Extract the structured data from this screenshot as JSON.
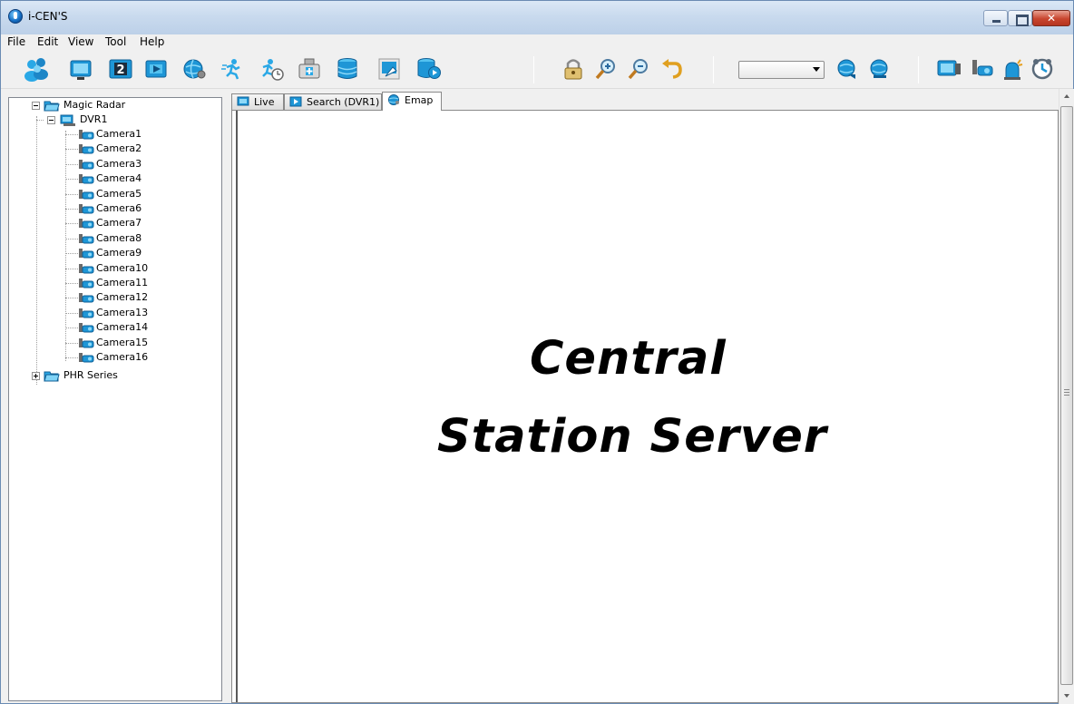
{
  "window": {
    "title": "i-CEN'S",
    "close_glyph": "✕"
  },
  "menu": [
    "File",
    "Edit",
    "View",
    "Tool",
    "Help"
  ],
  "toolbar": {
    "left_buttons": [
      "users-icon",
      "live-monitor-icon",
      "split-2-icon",
      "channel-view-icon",
      "globe-settings-icon",
      "motion-search-icon",
      "motion-schedule-icon",
      "backup-device-icon",
      "database-icon",
      "export-clip-icon",
      "database-play-icon"
    ],
    "map_buttons": [
      "lock-icon",
      "zoom-in-icon",
      "zoom-out-icon",
      "undo-icon"
    ],
    "combo_value": "",
    "globe_buttons": [
      "globe-prev-icon",
      "globe-next-icon"
    ],
    "right_buttons": [
      "monitor-camera-icon",
      "camera-icon",
      "alarm-bell-icon",
      "clock-icon"
    ]
  },
  "tree": {
    "root": {
      "label": "Magic Radar"
    },
    "dvr": {
      "label": "DVR1"
    },
    "cameras": [
      "Camera1",
      "Camera2",
      "Camera3",
      "Camera4",
      "Camera5",
      "Camera6",
      "Camera7",
      "Camera8",
      "Camera9",
      "Camera10",
      "Camera11",
      "Camera12",
      "Camera13",
      "Camera14",
      "Camera15",
      "Camera16"
    ],
    "series": {
      "label": "PHR Series"
    }
  },
  "tabs": [
    {
      "label": "Live",
      "icon": "monitor-icon",
      "active": false
    },
    {
      "label": "Search (DVR1)",
      "icon": "search-video-icon",
      "active": false
    },
    {
      "label": "Emap",
      "icon": "globe-icon",
      "active": true
    }
  ],
  "main": {
    "line1": "Central",
    "line2": "Station Server"
  },
  "colors": {
    "accent": "#1a9ad6",
    "title_bar": "#c9daee",
    "close_button": "#c8452e"
  }
}
